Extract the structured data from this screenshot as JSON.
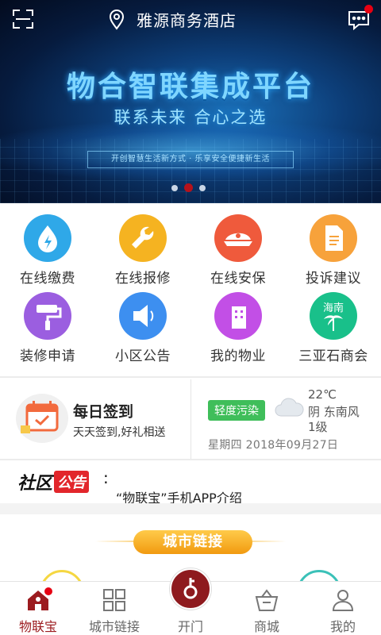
{
  "header": {
    "hotel_name": "雅源商务酒店",
    "icons": [
      "scan-icon",
      "location-pin-icon",
      "message-icon"
    ]
  },
  "banner": {
    "title": "物合智联集成平台",
    "subtitle": "联系未来 合心之选",
    "tagline": "开创智慧生活新方式 · 乐享安全便捷新生活",
    "slides": 3,
    "active_slide": 2
  },
  "services": [
    {
      "label": "在线缴费",
      "icon": "water-drop-icon",
      "color": "#2fa8e8"
    },
    {
      "label": "在线报修",
      "icon": "wrench-icon",
      "color": "#f5b321"
    },
    {
      "label": "在线安保",
      "icon": "police-cap-icon",
      "color": "#ef5a3c"
    },
    {
      "label": "投诉建议",
      "icon": "document-icon",
      "color": "#f7a23b"
    },
    {
      "label": "装修申请",
      "icon": "paint-roller-icon",
      "color": "#9b5ee0"
    },
    {
      "label": "小区公告",
      "icon": "speaker-icon",
      "color": "#3d8ff0"
    },
    {
      "label": "我的物业",
      "icon": "building-icon",
      "color": "#c24fe6"
    },
    {
      "label": "三亚石商会",
      "icon": "palm-tree-icon",
      "color": "#19c08a",
      "badge": "海南"
    }
  ],
  "checkin": {
    "title": "每日签到",
    "subtitle": "天天签到,好礼相送"
  },
  "weather": {
    "air_quality": "轻度污染",
    "temperature": "22℃",
    "wind": "阴 东南风",
    "level": "1级",
    "date": "星期四 2018年09月27日"
  },
  "notice": {
    "logo_part1": "社区",
    "logo_part2": "公告",
    "colon": ":",
    "text": "“物联宝”手机APP介绍"
  },
  "city_link": {
    "label": "城市链接"
  },
  "tabbar": {
    "tabs": [
      {
        "label": "物联宝",
        "icon": "home-icon",
        "active": true
      },
      {
        "label": "城市链接",
        "icon": "grid-icon",
        "active": false
      },
      {
        "label": "开门",
        "icon": "key-icon",
        "active": false
      },
      {
        "label": "商城",
        "icon": "basket-icon",
        "active": false
      },
      {
        "label": "我的",
        "icon": "user-icon",
        "active": false
      }
    ]
  },
  "colors": {
    "brand_red": "#9c1b1f",
    "dot_red": "#e60012"
  }
}
